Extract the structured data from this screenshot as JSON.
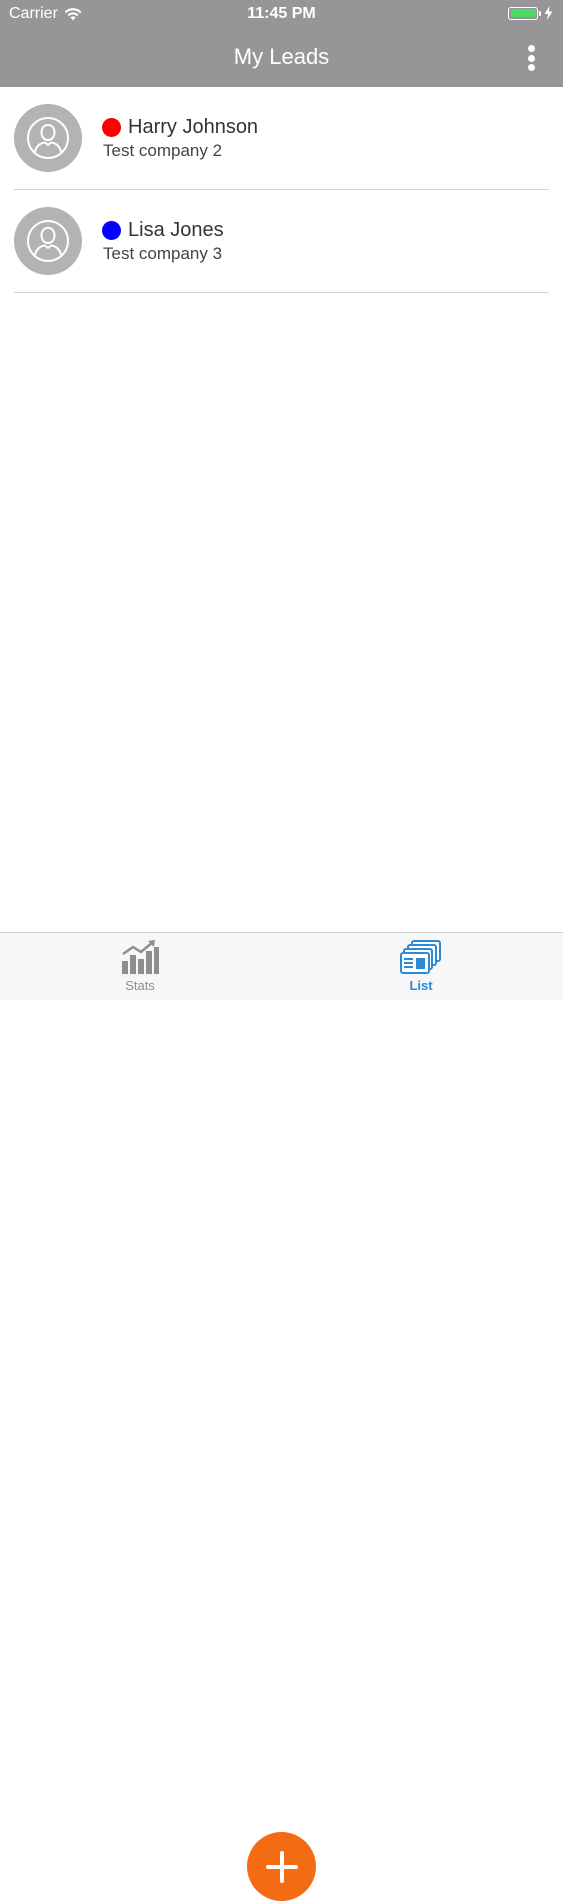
{
  "status_bar": {
    "carrier": "Carrier",
    "time": "11:45 PM",
    "battery_color": "#4cd964"
  },
  "nav": {
    "title": "My Leads",
    "more_icon": "more-vertical-icon"
  },
  "leads": [
    {
      "name": "Harry Johnson",
      "company": "Test company 2",
      "status_color": "#ff0000",
      "avatar_icon": "user-avatar-icon"
    },
    {
      "name": "Lisa Jones",
      "company": "Test company 3",
      "status_color": "#0000ff",
      "avatar_icon": "user-avatar-icon"
    }
  ],
  "tab_bar": {
    "tabs": [
      {
        "label": "Stats",
        "icon": "stats-chart-icon",
        "active": false
      },
      {
        "label": "List",
        "icon": "contact-cards-icon",
        "active": true
      }
    ],
    "add_button": {
      "icon": "plus-icon",
      "color": "#f36c13"
    }
  }
}
